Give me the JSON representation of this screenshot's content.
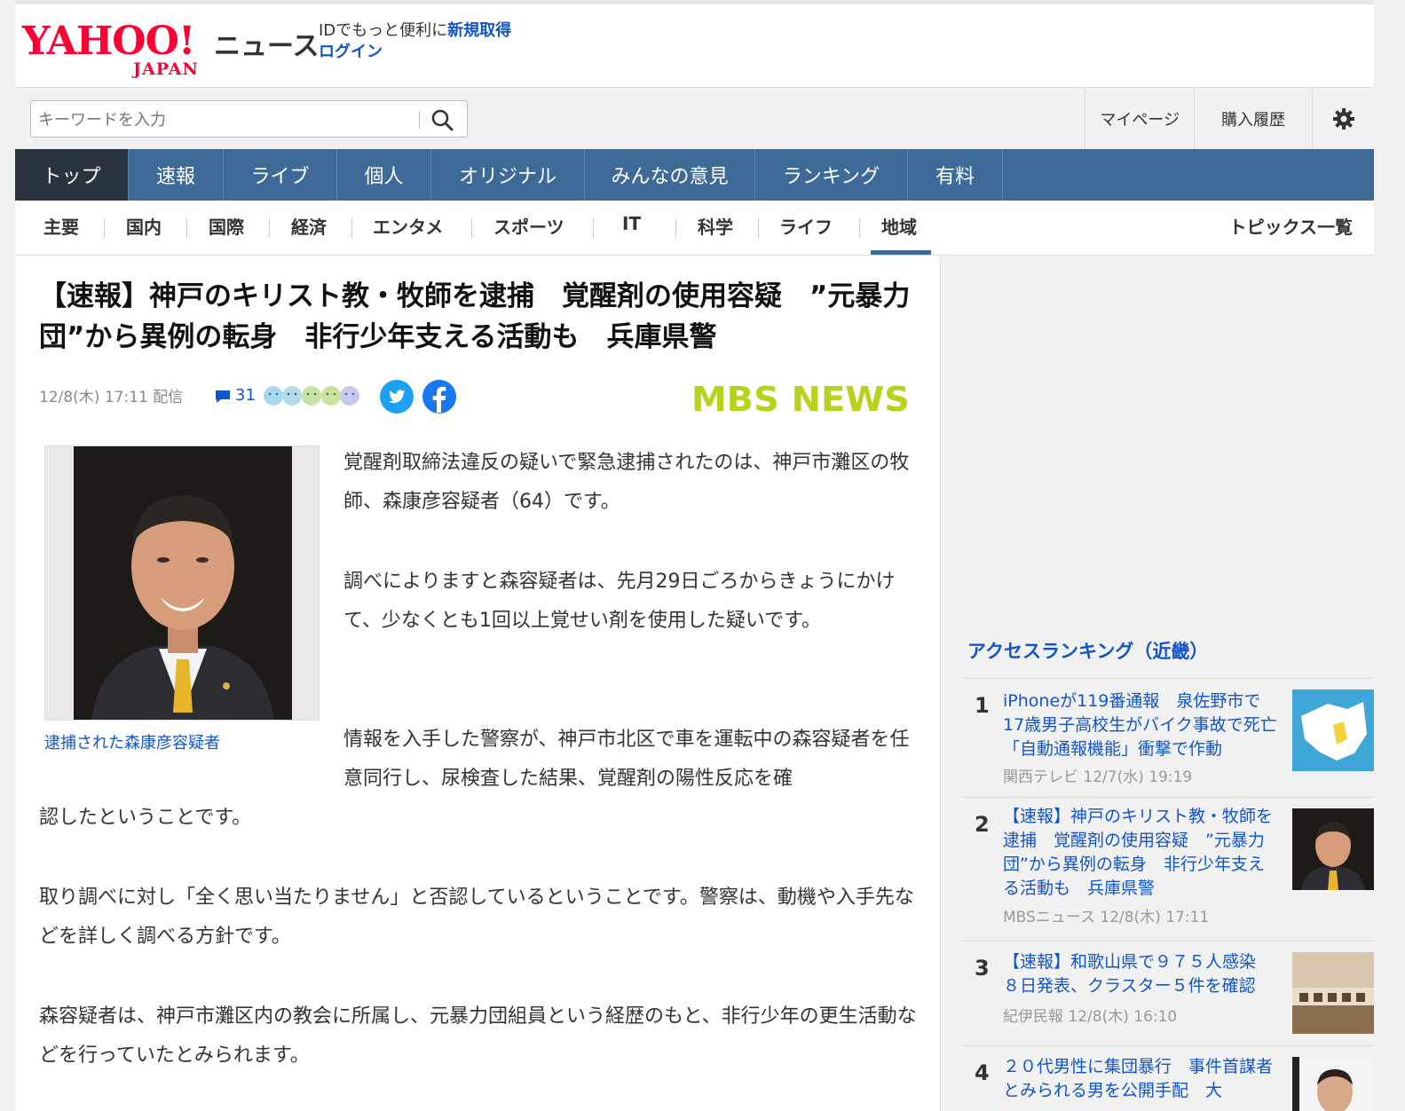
{
  "header": {
    "logo_text": "YAHOO!",
    "logo_sub": "JAPAN",
    "section": "ニュース",
    "login_prompt": "IDでもっと便利に",
    "signup": "新規取得",
    "login": "ログイン"
  },
  "search": {
    "placeholder": "キーワードを入力"
  },
  "toplinks": {
    "mypage": "マイページ",
    "history": "購入履歴"
  },
  "nav": [
    "トップ",
    "速報",
    "ライブ",
    "個人",
    "オリジナル",
    "みんなの意見",
    "ランキング",
    "有料"
  ],
  "subnav": [
    "主要",
    "国内",
    "国際",
    "経済",
    "エンタメ",
    "スポーツ",
    "IT",
    "科学",
    "ライフ",
    "地域"
  ],
  "subnav_topics": "トピックス一覧",
  "article": {
    "title": "【速報】神戸のキリスト教・牧師を逮捕　覚醒剤の使用容疑　”元暴力団”から異例の転身　非行少年支える活動も　兵庫県警",
    "date": "12/8(木) 17:11 配信",
    "comments": "31",
    "brand": "MBS NEWS",
    "caption": "逮捕された森康彦容疑者",
    "p1": "覚醒剤取締法違反の疑いで緊急逮捕されたのは、神戸市灘区の牧師、森康彦容疑者（64）です。",
    "p2": "調べによりますと森容疑者は、先月29日ごろからきょうにかけて、少なくとも1回以上覚せい剤を使用した疑いです。",
    "p3a": "情報を入手した警察が、神戸市北区で車を運転中の森容疑者を任意同行し、尿検査した結果、覚醒剤の陽性反応を確",
    "p3b": "認したということです。",
    "p4": "取り調べに対し「全く思い当たりません」と否認しているということです。警察は、動機や入手先などを詳しく調べる方針です。",
    "p5": "森容疑者は、神戸市灘区内の教会に所属し、元暴力団組員という経歴のもと、非行少年の更生活動などを行っていたとみられます。"
  },
  "ranking": {
    "title": "アクセスランキング（近畿）",
    "items": [
      {
        "num": "1",
        "text": "iPhoneが119番通報　泉佐野市で17歳男子高校生がバイク事故で死亡　「自動通報機能」衝撃で作動",
        "source": "関西テレビ 12/7(水) 19:19"
      },
      {
        "num": "2",
        "text": "【速報】神戸のキリスト教・牧師を逮捕　覚醒剤の使用容疑　”元暴力団”から異例の転身　非行少年支える活動も　兵庫県警",
        "source": "MBSニュース 12/8(木) 17:11"
      },
      {
        "num": "3",
        "text": "【速報】和歌山県で９７５人感染　８日発表、クラスター５件を確認",
        "source": "紀伊民報 12/8(木) 16:10"
      },
      {
        "num": "4",
        "text": "２０代男性に集団暴行　事件首謀者とみられる男を公開手配　大",
        "source": ""
      }
    ]
  }
}
